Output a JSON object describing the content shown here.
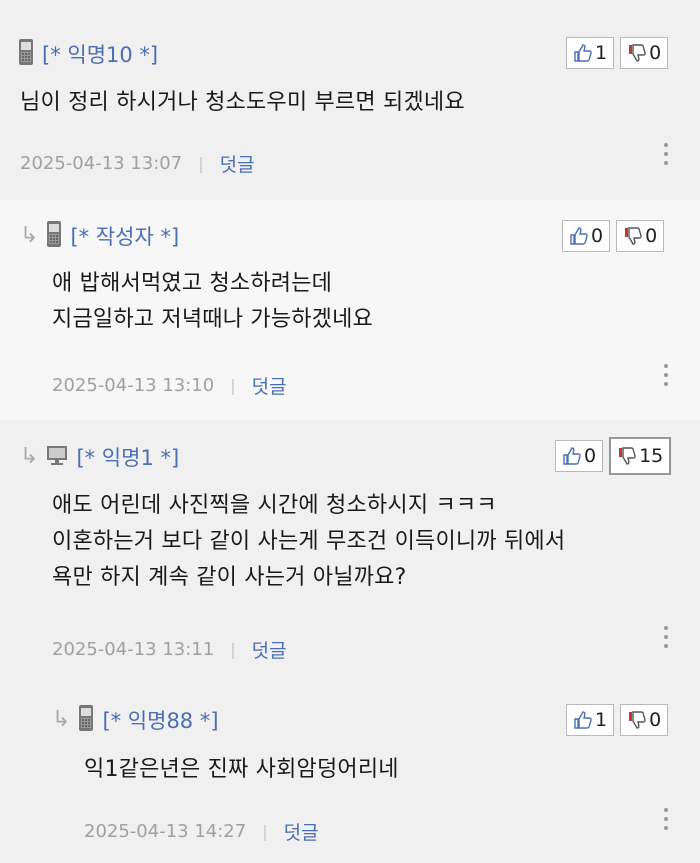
{
  "comments": [
    {
      "author": "[* 익명10 *]",
      "device": "phone",
      "up": "1",
      "down": "0",
      "lines": [
        "님이 정리 하시거나 청소도우미 부르면 되겠네요"
      ],
      "date": "2025-04-13 13:07",
      "reply_label": "덧글"
    },
    {
      "author": "[* 작성자 *]",
      "device": "phone",
      "up": "0",
      "down": "0",
      "lines": [
        "애 밥해서먹였고 청소하려는데",
        "지금일하고 저녁때나 가능하겠네요"
      ],
      "date": "2025-04-13 13:10",
      "reply_label": "덧글"
    },
    {
      "author": "[* 익명1 *]",
      "device": "pc",
      "up": "0",
      "down": "15",
      "lines": [
        "애도 어린데 사진찍을 시간에 청소하시지 ㅋㅋㅋ",
        "이혼하는거 보다 같이 사는게 무조건 이득이니까 뒤에서",
        "욕만 하지 계속 같이 사는거 아닐까요?"
      ],
      "date": "2025-04-13 13:11",
      "reply_label": "덧글"
    },
    {
      "author": "[* 익명88 *]",
      "device": "phone",
      "up": "1",
      "down": "0",
      "lines": [
        "익1같은년은 진짜 사회암덩어리네"
      ],
      "date": "2025-04-13 14:27",
      "reply_label": "덧글"
    }
  ],
  "icons": {
    "reply_arrow": "↳",
    "thumb_up": "thumb-up-icon",
    "thumb_down": "thumb-down-icon",
    "more": "more-vertical-icon",
    "phone": "mobile-phone-icon",
    "pc": "desktop-pc-icon"
  },
  "colors": {
    "author": "#4a6fb5",
    "thumb_down_accent": "#c0392b",
    "meta": "#a0a0a0"
  }
}
